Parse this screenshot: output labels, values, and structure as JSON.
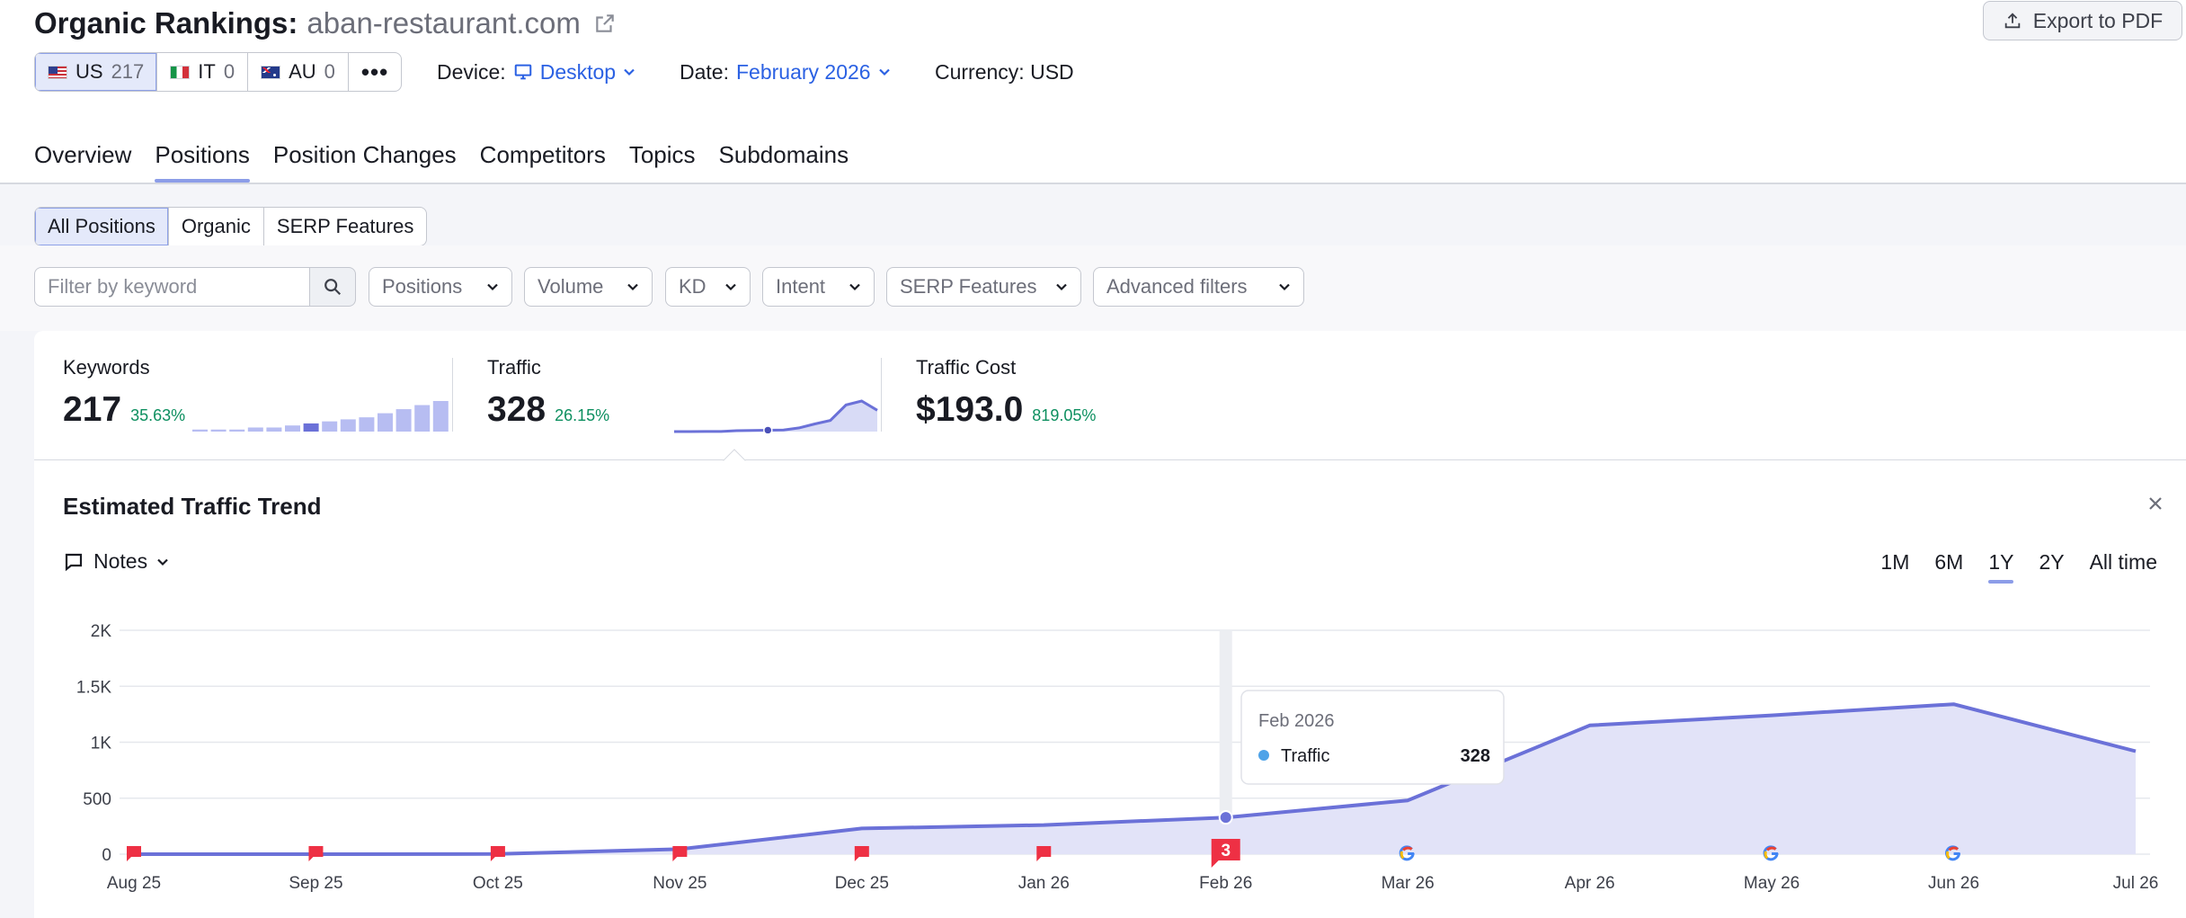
{
  "header": {
    "title_prefix": "Organic Rankings:",
    "domain": "aban-restaurant.com",
    "export_label": "Export to PDF"
  },
  "databases": [
    {
      "code": "US",
      "count": "217",
      "flag": "us-flag",
      "active": true
    },
    {
      "code": "IT",
      "count": "0",
      "flag": "it-flag",
      "active": false
    },
    {
      "code": "AU",
      "count": "0",
      "flag": "au-flag",
      "active": false
    }
  ],
  "more_label": "•••",
  "device": {
    "label": "Device:",
    "value": "Desktop"
  },
  "date": {
    "label": "Date:",
    "value": "February 2026"
  },
  "currency": {
    "label": "Currency: USD"
  },
  "tabs": [
    "Overview",
    "Positions",
    "Position Changes",
    "Competitors",
    "Topics",
    "Subdomains"
  ],
  "active_tab": "Positions",
  "subtabs": [
    "All Positions",
    "Organic",
    "SERP Features"
  ],
  "filters": {
    "keyword_placeholder": "Filter by keyword",
    "dropdowns": [
      "Positions",
      "Volume",
      "KD",
      "Intent",
      "SERP Features",
      "Advanced filters"
    ]
  },
  "metrics": {
    "keywords": {
      "label": "Keywords",
      "value": "217",
      "change": "35.63%",
      "spark": [
        1,
        1,
        1,
        2,
        2,
        3,
        4,
        5,
        6,
        7,
        9,
        11,
        13,
        15
      ]
    },
    "traffic": {
      "label": "Traffic",
      "value": "328",
      "change": "26.15%",
      "spark": [
        0,
        0,
        2,
        3,
        40,
        45,
        60,
        70,
        160,
        330,
        480,
        1150,
        1320,
        920
      ]
    },
    "traffic_cost": {
      "label": "Traffic Cost",
      "value": "$193.0",
      "change": "819.05%"
    }
  },
  "trend": {
    "title": "Estimated Traffic Trend",
    "notes_label": "Notes",
    "ranges": [
      "1M",
      "6M",
      "1Y",
      "2Y",
      "All time"
    ],
    "active_range": "1Y",
    "tooltip": {
      "date": "Feb 2026",
      "series": "Traffic",
      "value": "328"
    },
    "note_badge": "3"
  },
  "colors": {
    "accent": "#6b71d8",
    "area": "#e2e3f8",
    "positive": "#0c8f5f",
    "link": "#2b61e3",
    "note_red": "#ee3044"
  },
  "chart_data": {
    "type": "area",
    "x": [
      "Aug 25",
      "Sep 25",
      "Oct 25",
      "Nov 25",
      "Dec 25",
      "Jan 26",
      "Feb 26",
      "Mar 26",
      "Apr 26",
      "May 26",
      "Jun 26",
      "Jul 26"
    ],
    "series": [
      {
        "name": "Traffic",
        "values": [
          0,
          0,
          2,
          45,
          230,
          260,
          328,
          480,
          1150,
          1240,
          1340,
          920
        ]
      }
    ],
    "y_ticks": [
      "0",
      "500",
      "1K",
      "1.5K",
      "2K"
    ],
    "ylim": [
      0,
      2000
    ],
    "grid": true,
    "note_flags": [
      "Aug 25",
      "Sep 25",
      "Oct 25",
      "Nov 25",
      "Dec 25",
      "Jan 26",
      "Feb 26"
    ],
    "google_markers": [
      "Mar 26",
      "May 26",
      "Jun 26"
    ],
    "highlight": "Feb 26"
  }
}
